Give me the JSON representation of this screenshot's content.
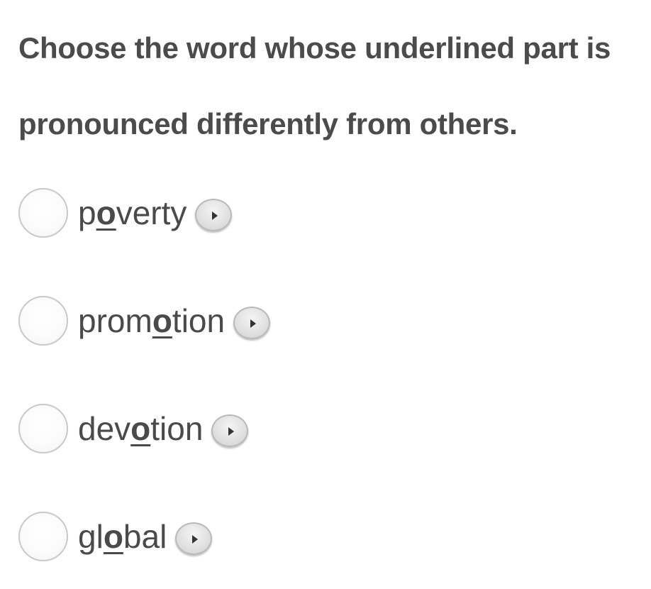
{
  "question": {
    "line1": "Choose the word whose underlined part is",
    "line2": "pronounced differently from others."
  },
  "options": [
    {
      "pre": "p",
      "underlined": "o",
      "post": "verty",
      "audio_icon": "play-icon"
    },
    {
      "pre": "prom",
      "underlined": "o",
      "post": "tion",
      "audio_icon": "play-icon"
    },
    {
      "pre": "dev",
      "underlined": "o",
      "post": "tion",
      "audio_icon": "play-icon"
    },
    {
      "pre": "gl",
      "underlined": "o",
      "post": "bal",
      "audio_icon": "play-icon"
    }
  ]
}
